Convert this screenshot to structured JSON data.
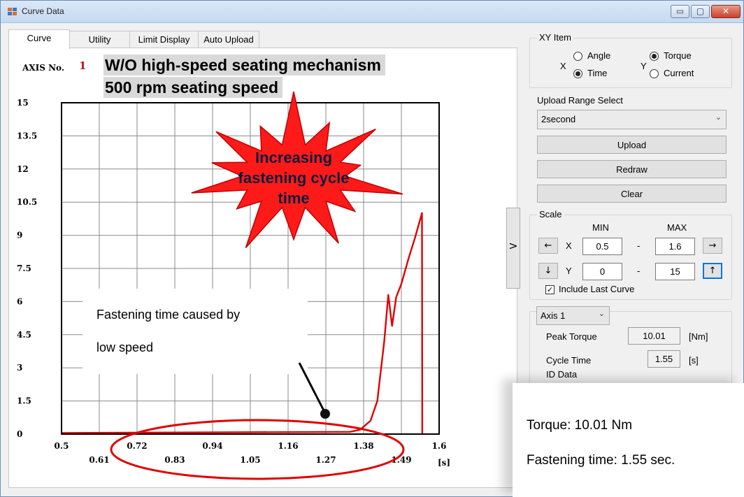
{
  "window": {
    "title": "Curve Data",
    "controls": {
      "minimize": "▭",
      "maximize": "▢",
      "close": "✕"
    }
  },
  "tabs": [
    {
      "label": "Curve",
      "active": true
    },
    {
      "label": "Utility",
      "active": false
    },
    {
      "label": "Limit Display",
      "active": false
    },
    {
      "label": "Auto Upload",
      "active": false
    }
  ],
  "plot": {
    "axis_no_label": "AXIS No.",
    "axis_no_value": "1",
    "headline_1": "W/O high-speed seating mechanism",
    "headline_2": "500 rpm seating speed",
    "burst_lines": [
      "Increasing",
      "fastening cycle",
      "time"
    ],
    "callout_lines": [
      "Fastening time caused by",
      "low speed"
    ],
    "x_unit": "[s]"
  },
  "summary": {
    "torque": "Torque: 10.01 Nm",
    "time": "Fastening time: 1.55 sec."
  },
  "panel": {
    "xy_item": {
      "title": "XY Item",
      "x_label": "X",
      "y_label": "Y",
      "x_options": [
        {
          "label": "Angle",
          "selected": false
        },
        {
          "label": "Time",
          "selected": true
        }
      ],
      "y_options": [
        {
          "label": "Torque",
          "selected": true
        },
        {
          "label": "Current",
          "selected": false
        }
      ]
    },
    "upload_range": {
      "label": "Upload Range Select",
      "value": "2second"
    },
    "buttons": {
      "upload": "Upload",
      "redraw": "Redraw",
      "clear": "Clear"
    },
    "toggle_arrow": ">",
    "scale": {
      "title": "Scale",
      "min_header": "MIN",
      "max_header": "MAX",
      "x_label": "X",
      "y_label": "Y",
      "x_min": "0.5",
      "x_max": "1.6",
      "y_min": "0",
      "y_max": "15",
      "separator": "-",
      "left_arrow": "←",
      "right_arrow": "→",
      "down_arrow": "↓",
      "up_arrow": "↑",
      "include_last_curve": "Include Last Curve",
      "include_checked": true
    },
    "axis_select": "Axis 1",
    "peak_torque": {
      "label": "Peak Torque",
      "value": "10.01",
      "unit": "[Nm]"
    },
    "cycle_time": {
      "label": "Cycle Time",
      "value": "1.55",
      "unit": "[s]"
    },
    "id_data": "ID Data"
  },
  "colors": {
    "curve": "#e00000",
    "burst": "#ff1a1a",
    "axis_no": "#b01818",
    "focus": "#0078d7"
  },
  "chart_data": {
    "type": "line",
    "xlabel": "[s]",
    "ylabel": "",
    "xlim": [
      0.5,
      1.6
    ],
    "ylim": [
      0,
      15
    ],
    "x_ticks_upper": [
      "0.5",
      "0.72",
      "0.94",
      "1.16",
      "1.38",
      "1.6"
    ],
    "x_ticks_lower": [
      "0.61",
      "0.83",
      "1.05",
      "1.27",
      "1.49"
    ],
    "y_ticks": [
      "0",
      "1.5",
      "3",
      "4.5",
      "6",
      "7.5",
      "9",
      "10.5",
      "12",
      "13.5",
      "15"
    ],
    "grid": true,
    "series": [
      {
        "values": [
          [
            0.5,
            0.05
          ],
          [
            1.34,
            0.1
          ],
          [
            1.37,
            0.2
          ],
          [
            1.4,
            0.6
          ],
          [
            1.42,
            1.5
          ],
          [
            1.44,
            4.2
          ],
          [
            1.452,
            6.3
          ],
          [
            1.463,
            4.9
          ],
          [
            1.475,
            6.2
          ],
          [
            1.49,
            6.8
          ],
          [
            1.51,
            7.9
          ],
          [
            1.53,
            8.9
          ],
          [
            1.55,
            10.01
          ],
          [
            1.551,
            0
          ]
        ]
      }
    ]
  }
}
